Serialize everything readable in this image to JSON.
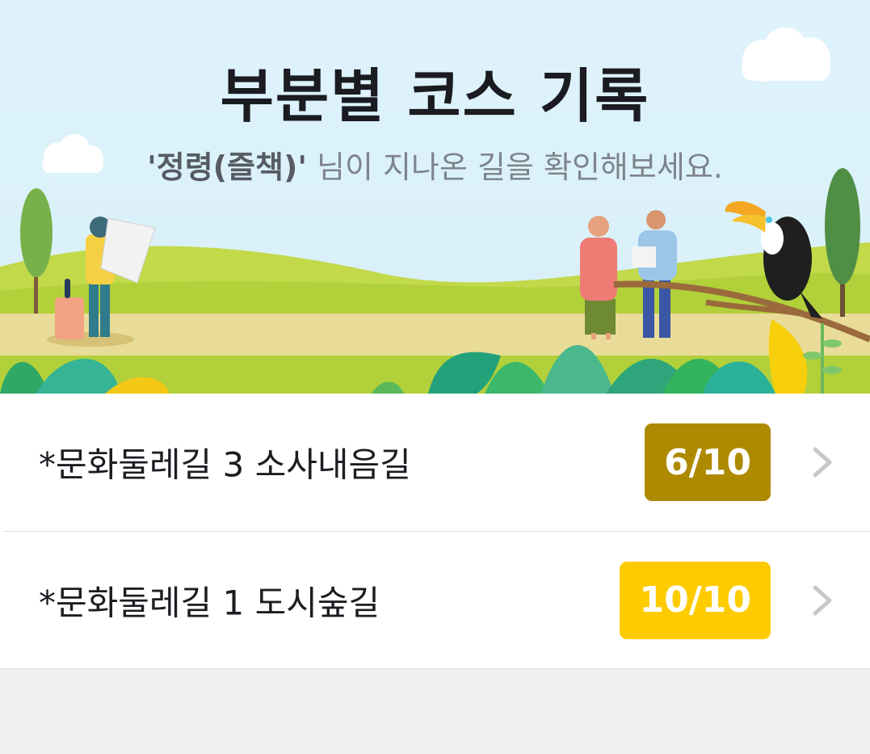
{
  "header": {
    "title": "부분별 코스 기록",
    "user_name": "'정령(즐책)'",
    "subtitle_rest": " 님이 지나온 길을 확인해보세요."
  },
  "courses": [
    {
      "name": "*문화둘레길 3 소사내음길",
      "progress": "6/10",
      "progress_fraction": 0.6,
      "badge_color": "#ad8a00"
    },
    {
      "name": "*문화둘레길 1 도시숲길",
      "progress": "10/10",
      "progress_fraction": 1.0,
      "badge_color": "#fecb00"
    }
  ],
  "icons": {
    "row_arrow": "chevron-right-icon"
  },
  "colors": {
    "sky": "#def3fb",
    "grass": "#b8d43a",
    "path": "#e9dc98",
    "list_background": "#ffffff",
    "page_background": "#eeeff1"
  }
}
